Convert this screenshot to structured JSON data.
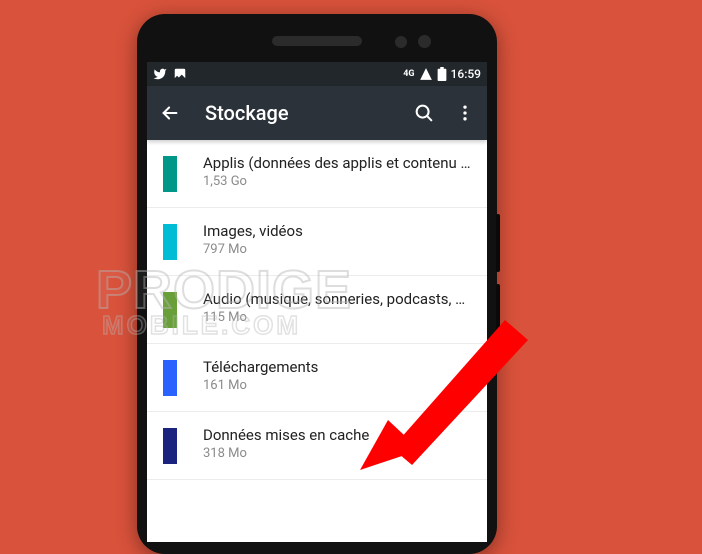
{
  "statusbar": {
    "network_label": "4G",
    "time": "16:59"
  },
  "appbar": {
    "title": "Stockage"
  },
  "rows": [
    {
      "color": "#009688",
      "title": "Applis (données des applis et contenu multi..",
      "sub": "1,53 Go"
    },
    {
      "color": "#00bcd4",
      "title": "Images, vidéos",
      "sub": "797 Mo"
    },
    {
      "color": "#689f38",
      "title": "Audio (musique, sonneries, podcasts, etc.)",
      "sub": "115 Mo"
    },
    {
      "color": "#2962ff",
      "title": "Téléchargements",
      "sub": "161 Mo"
    },
    {
      "color": "#1a237e",
      "title": "Données mises en cache",
      "sub": "318 Mo"
    }
  ],
  "watermark": {
    "line1": "PRODIGE",
    "line2": "MOBILE.COM"
  }
}
